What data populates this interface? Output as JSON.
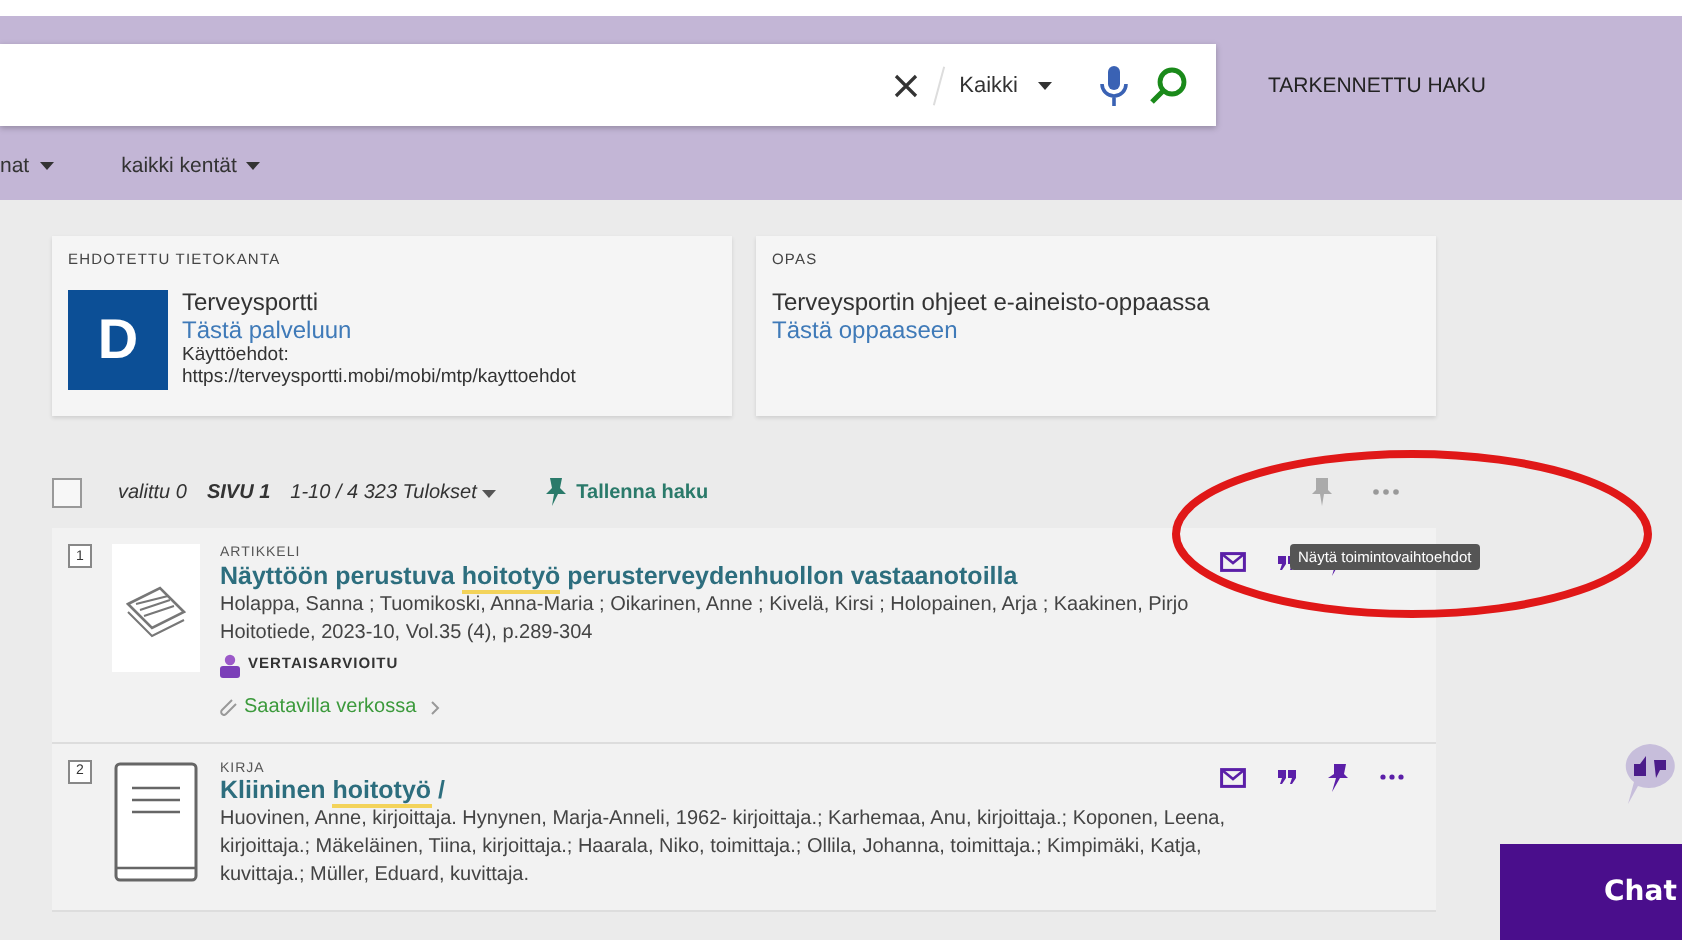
{
  "header": {
    "search": {
      "scope": "Kaikki"
    },
    "advanced_link": "TARKENNETTU HAKU",
    "filters": [
      "nat",
      "kaikki kentät"
    ]
  },
  "suggestions": [
    {
      "heading": "EHDOTETTU TIETOKANTA",
      "logo_letter": "D",
      "title": "Terveysportti",
      "link": "Tästä palveluun",
      "note_label": "Käyttöehdot:",
      "note_url": "https://terveysportti.mobi/mobi/mtp/kayttoehdot"
    },
    {
      "heading": "OPAS",
      "title": "Terveysportin ohjeet e-aineisto-oppaassa",
      "link": "Tästä oppaaseen"
    }
  ],
  "toolbar": {
    "checked": false,
    "selected_label": "valittu 0",
    "page": "SIVU 1",
    "range": "1-10 / 4 323 Tulokset",
    "save": "Tallenna haku"
  },
  "tooltip": "Näytä toimintovaihtoehdot",
  "results": [
    {
      "number": "1",
      "kind": "article",
      "type": "ARTIKKELI",
      "title": [
        {
          "text": "Näyttöön perustuva ",
          "highlight": false
        },
        {
          "text": "hoitotyö",
          "highlight": true
        },
        {
          "text": " perusterveydenhuollon vastaanotoilla",
          "highlight": false
        }
      ],
      "authors": "Holappa, Sanna ; Tuomikoski, Anna-Maria ; Oikarinen, Anne ; Kivelä, Kirsi ; Holopainen, Arja ; Kaakinen, Pirjo",
      "source": "Hoitotiede, 2023-10, Vol.35 (4), p.289-304",
      "peer_review": "VERTAISARVIOITU",
      "availability": "Saatavilla verkossa"
    },
    {
      "number": "2",
      "kind": "book",
      "type": "KIRJA",
      "title": [
        {
          "text": "Kliininen ",
          "highlight": false
        },
        {
          "text": "hoitotyö",
          "highlight": true
        },
        {
          "text": " /",
          "highlight": false
        }
      ],
      "authors": "Huovinen, Anne, kirjoittaja. Hynynen, Marja-Anneli, 1962- kirjoittaja.; Karhemaa, Anu, kirjoittaja.; Koponen, Leena, kirjoittaja.; Mäkeläinen, Tiina, kirjoittaja.; Haarala, Niko, toimittaja.; Ollila, Johanna, toimittaja.; Kimpimäki, Katja, kuvittaja.; Müller, Eduard, kuvittaja."
    }
  ],
  "chat": "Chat"
}
